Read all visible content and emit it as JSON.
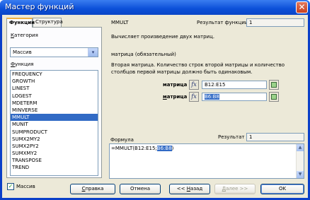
{
  "window": {
    "title": "Мастер функций",
    "close_glyph": "✕"
  },
  "tabs": [
    {
      "label": "Функции"
    },
    {
      "label": "Структура"
    }
  ],
  "left": {
    "category_label_u": "К",
    "category_label_rest": "атегория",
    "category_value": "Массив",
    "function_label_u": "Ф",
    "function_label_rest": "ункция",
    "functions": [
      "FREQUENCY",
      "GROWTH",
      "LINEST",
      "LOGEST",
      "MDETERM",
      "MINVERSE",
      "MMULT",
      "MUNIT",
      "SUMPRODUCT",
      "SUMX2MY2",
      "SUMX2PY2",
      "SUMXMY2",
      "TRANSPOSE",
      "TREND"
    ],
    "selected_function": "MMULT"
  },
  "right": {
    "function_name": "MMULT",
    "result_label": "Результат функции",
    "result_value": "1",
    "description": "Вычисляет произведение двух матриц.",
    "param_title": "матрица (обязательный)",
    "param_desc_line1": "Вторая матрица. Количество строк второй матрицы и количество",
    "param_desc_line2": "столбцов первой матрицы должно быть одинаковым.",
    "arg1_label": "матрица",
    "arg1_value": "B12:E15",
    "arg2_label_u": "м",
    "arg2_label_rest": "атрица",
    "arg2_value": "B6:B8",
    "fx_glyph": "fx",
    "formula_label": "Формула",
    "formula_result_label": "Результат",
    "formula_result_value": "1",
    "formula_prefix": "=MMULT(B12:E15;",
    "formula_highlight": "B6:B8",
    "formula_suffix": ")"
  },
  "array_checkbox": {
    "label": "Массив",
    "checked": true,
    "check_glyph": "✓"
  },
  "buttons": {
    "help_u": "С",
    "help_rest": "правка",
    "cancel": "Отмена",
    "back_prefix": "<< ",
    "back_u": "Н",
    "back_rest": "азад",
    "next_u": "Д",
    "next_rest": "алее >>",
    "ok": "OK"
  },
  "icons": {
    "dropdown": "chevron-down-icon",
    "scroll_up": "▲",
    "scroll_down": "▼",
    "arrow_glyph": "▾"
  }
}
